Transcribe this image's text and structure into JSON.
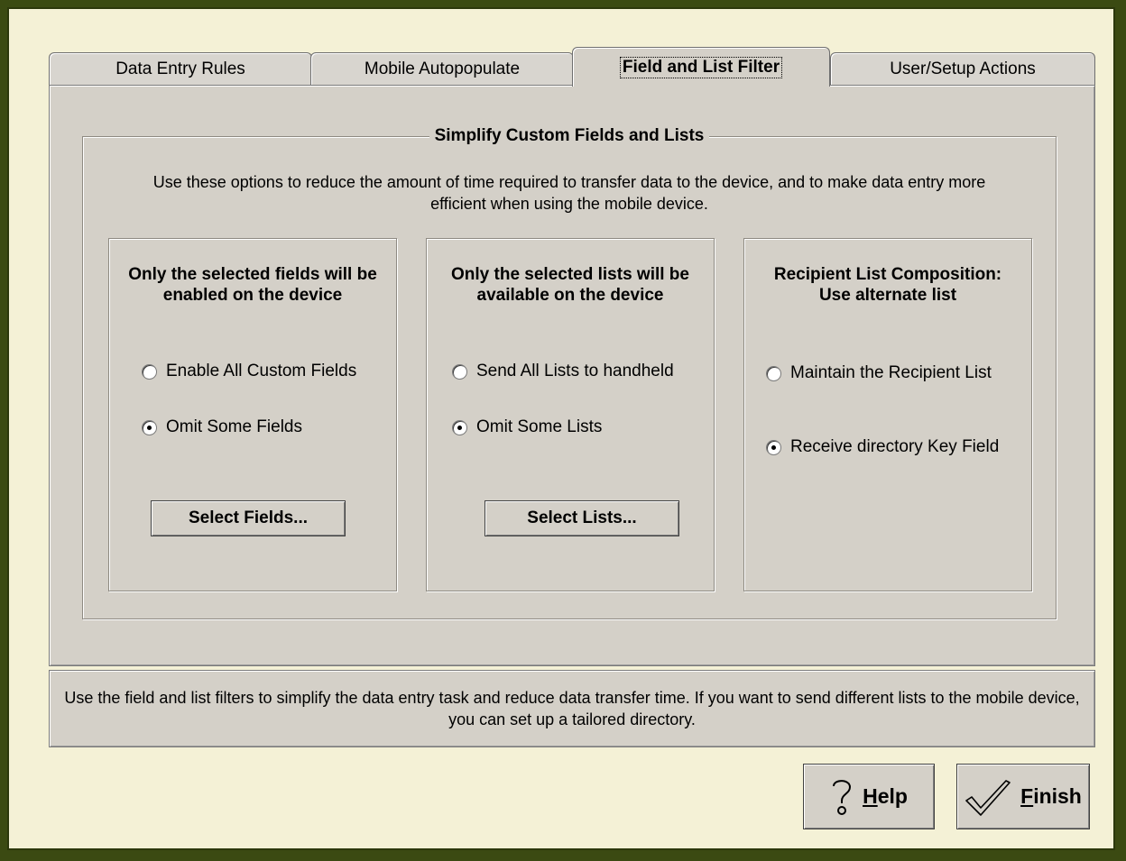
{
  "tabs": [
    {
      "label": "Data Entry Rules"
    },
    {
      "label": "Mobile Autopopulate"
    },
    {
      "label": "Field and List Filter",
      "active": true
    },
    {
      "label": "User/Setup Actions"
    }
  ],
  "group": {
    "title": "Simplify Custom Fields and Lists",
    "intro": "Use these options to reduce the amount of time required to transfer data to the device, and to make data entry more efficient when using the mobile device."
  },
  "fields_panel": {
    "title": "Only the selected fields will be\nenabled on the device",
    "option1": "Enable All Custom Fields",
    "option2": "Omit Some Fields",
    "selected": 2,
    "button": "Select Fields..."
  },
  "lists_panel": {
    "title": "Only the selected lists will be\navailable on the device",
    "option1": "Send All Lists to handheld",
    "option2": "Omit Some Lists",
    "selected": 2,
    "button": "Select Lists..."
  },
  "recipient_panel": {
    "title": "Recipient List Composition:\nUse alternate list",
    "option1": "Maintain the Recipient List",
    "option2": "Receive directory Key Field",
    "selected": 2
  },
  "status_text": "Use the field and list filters to simplify the data entry task and reduce data transfer time.  If you want to send different lists to the mobile device, you can set up a tailored directory.",
  "buttons": {
    "help_prefix": "",
    "help_mnemonic": "H",
    "help_rest": "elp",
    "finish_mnemonic": "F",
    "finish_rest": "inish"
  },
  "icons": {
    "help": "question-mark-icon",
    "finish": "checkmark-icon"
  },
  "colors": {
    "frame": "#3b4a12",
    "window_bg": "#f4f1d6",
    "control_bg": "#d4d0c8"
  }
}
